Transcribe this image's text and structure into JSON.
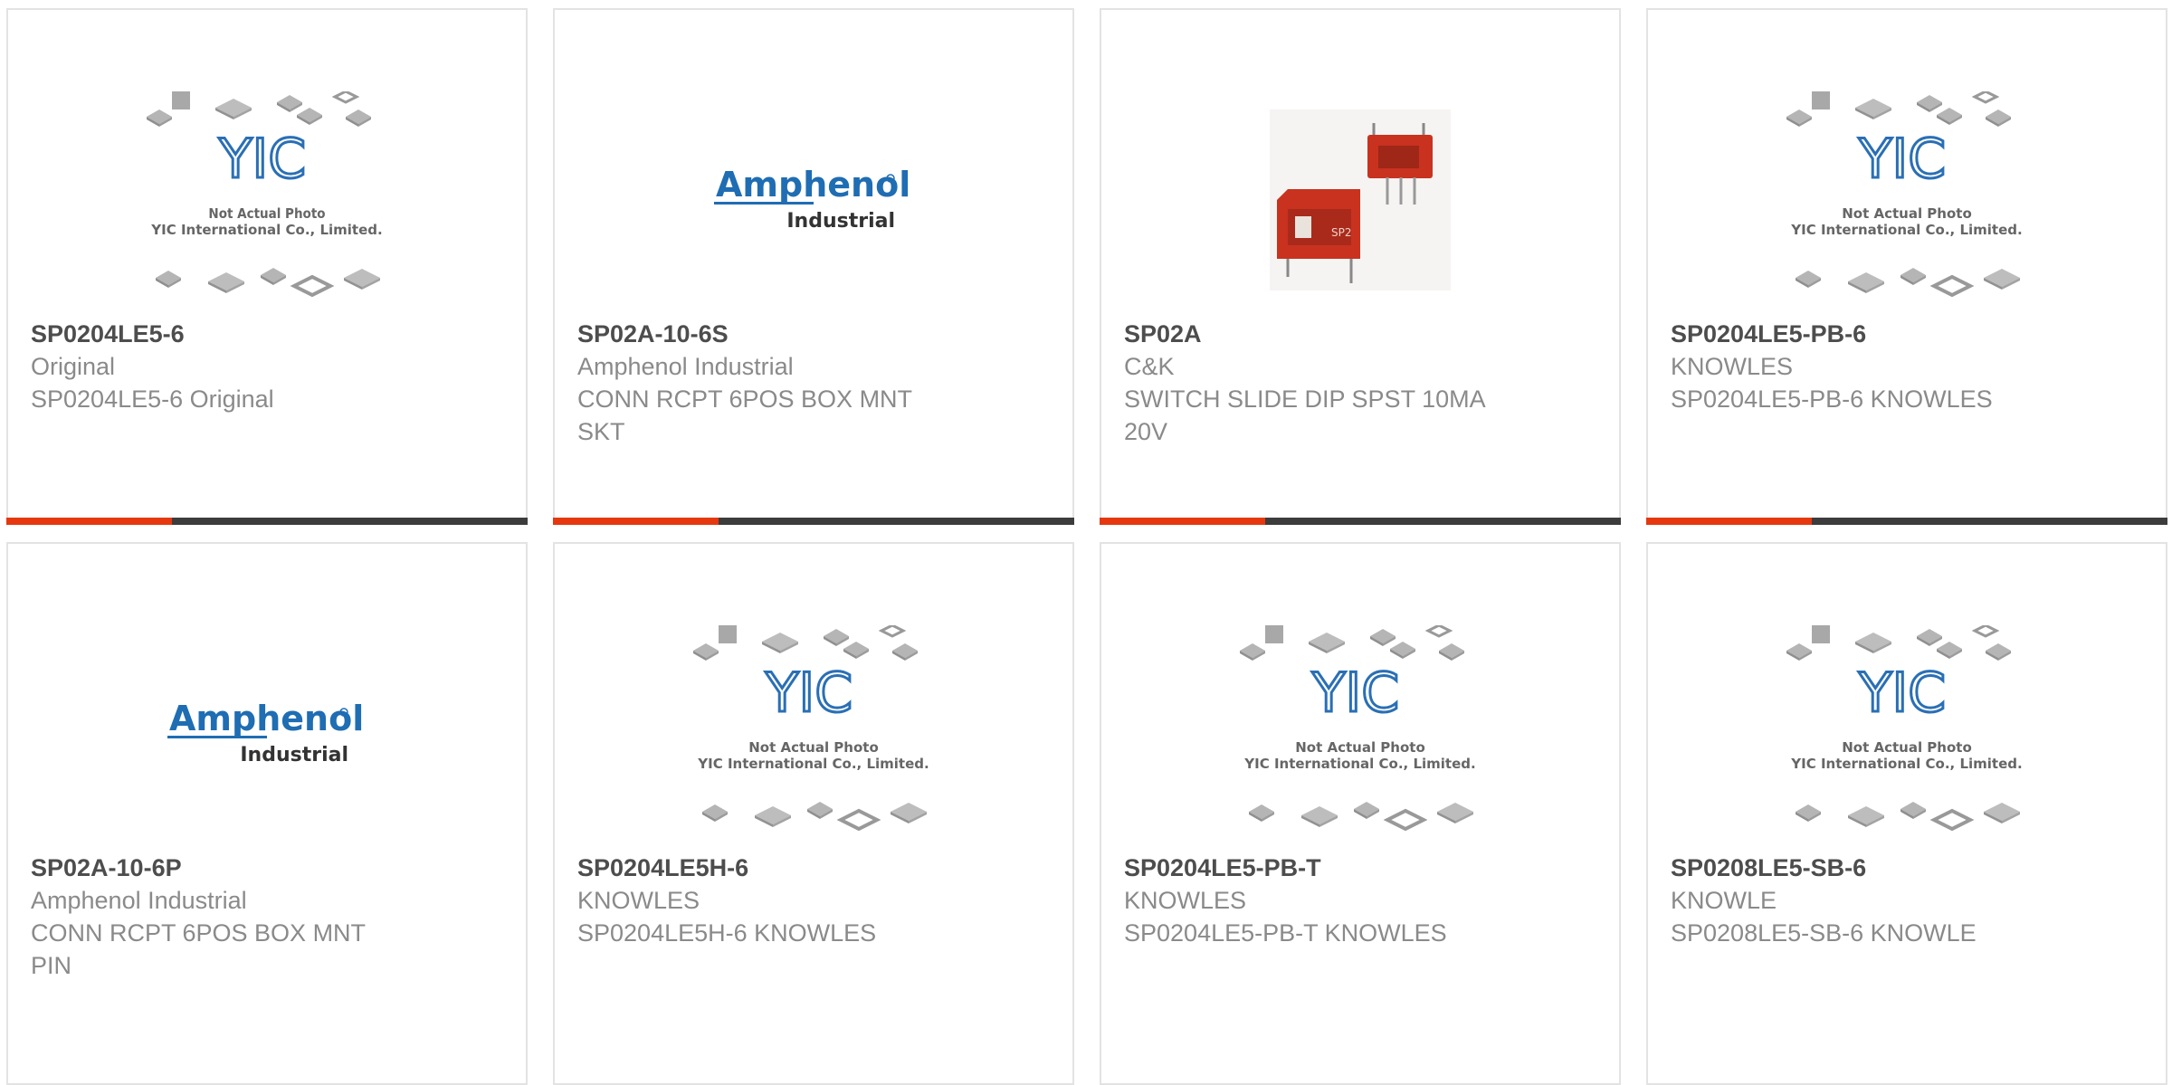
{
  "image_labels": {
    "placeholder_logo": "YIC",
    "placeholder_line1": "Not Actual Photo",
    "placeholder_line2": "YIC International Co., Limited.",
    "amphenol_main": "Amphenol",
    "amphenol_sub": "Industrial",
    "switch_marking": "SP2"
  },
  "products": [
    {
      "part": "SP0204LE5-6",
      "manufacturer": "Original",
      "description": "SP0204LE5-6 Original",
      "image": "not-actual-photo-icon"
    },
    {
      "part": "SP02A-10-6S",
      "manufacturer": "Amphenol Industrial",
      "description": "CONN RCPT 6POS BOX MNT SKT",
      "image": "amphenol-logo-icon"
    },
    {
      "part": "SP02A",
      "manufacturer": "C&K",
      "description": "SWITCH SLIDE DIP SPST 10MA 20V",
      "image": "slide-switch-photo-icon"
    },
    {
      "part": "SP0204LE5-PB-6",
      "manufacturer": "KNOWLES",
      "description": "SP0204LE5-PB-6 KNOWLES",
      "image": "not-actual-photo-icon"
    },
    {
      "part": "SP02A-10-6P",
      "manufacturer": "Amphenol Industrial",
      "description": "CONN RCPT 6POS BOX MNT PIN",
      "image": "amphenol-logo-icon"
    },
    {
      "part": "SP0204LE5H-6",
      "manufacturer": "KNOWLES",
      "description": "SP0204LE5H-6 KNOWLES",
      "image": "not-actual-photo-icon"
    },
    {
      "part": "SP0204LE5-PB-T",
      "manufacturer": "KNOWLES",
      "description": "SP0204LE5-PB-T KNOWLES",
      "image": "not-actual-photo-icon"
    },
    {
      "part": "SP0208LE5-SB-6",
      "manufacturer": "KNOWLE",
      "description": "SP0208LE5-SB-6 KNOWLE",
      "image": "not-actual-photo-icon"
    }
  ],
  "colors": {
    "accent": "#e5380f",
    "bar": "#3c3c3c",
    "amphenol_blue": "#1f6db3",
    "yic_blue": "#2a6fb5",
    "switch_red": "#c8321f"
  }
}
